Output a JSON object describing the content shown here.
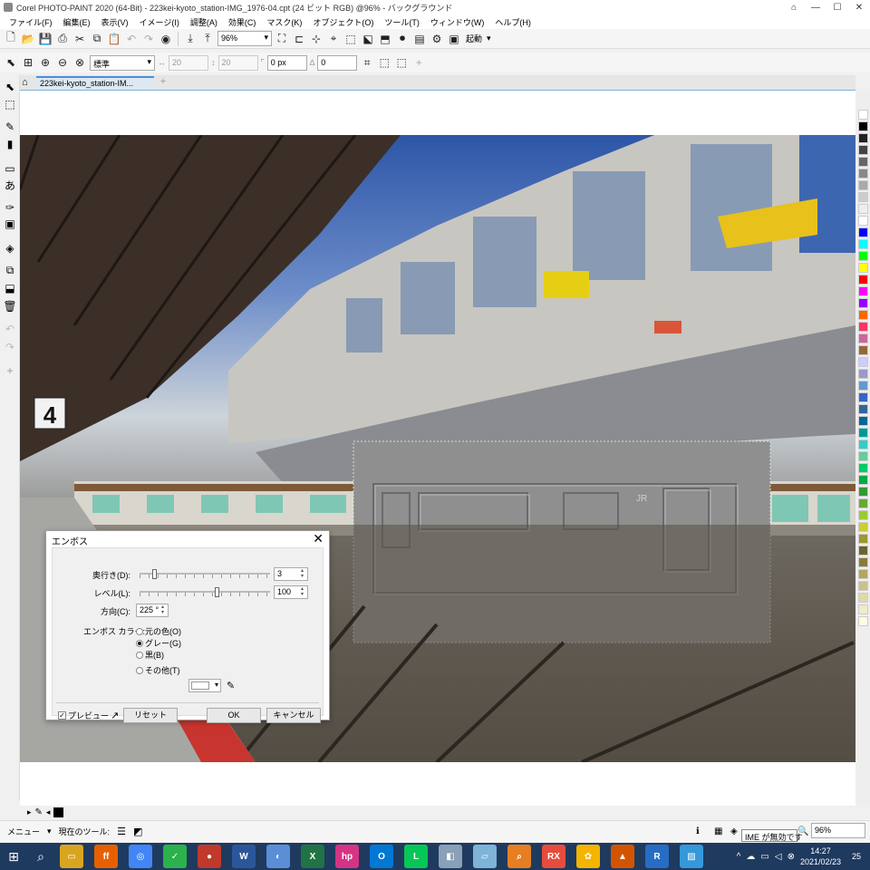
{
  "window": {
    "title": "Corel PHOTO-PAINT 2020 (64-Bit) - 223kei-kyoto_station-IMG_1976-04.cpt (24 ビット RGB) @96% - バックグラウンド",
    "min": "—",
    "max": "☐",
    "close": "✕"
  },
  "menu": [
    "ファイル(F)",
    "編集(E)",
    "表示(V)",
    "イメージ(I)",
    "調整(A)",
    "効果(C)",
    "マスク(K)",
    "オブジェクト(O)",
    "ツール(T)",
    "ウィンドウ(W)",
    "ヘルプ(H)"
  ],
  "toolbar": {
    "zoom": "96%",
    "launch": "起動"
  },
  "property_bar": {
    "mode": "標準",
    "width": "20",
    "height": "20",
    "feather": "0 px",
    "angle": "0"
  },
  "tabs": {
    "doc_tab": "223kei-kyoto_station-IM..."
  },
  "photo": {
    "platform_sign": "4",
    "train_logo": "JR"
  },
  "dialog": {
    "title": "エンボス",
    "depth_label": "奥行き(D):",
    "depth_value": "3",
    "level_label": "レベル(L):",
    "level_value": "100",
    "direction_label": "方向(C):",
    "direction_value": "225 °",
    "color_label": "エンボス カラー:",
    "options": [
      "元の色(O)",
      "グレー(G)",
      "黒(B)",
      "その他(T)"
    ],
    "selected_option": "グレー(G)",
    "depth_level": 0.1,
    "level_level": 0.6,
    "preview_label": "プレビュー",
    "reset_label": "リセット",
    "ok_label": "OK",
    "cancel_label": "キャンセル"
  },
  "status": {
    "menu_label": "メニュー",
    "current_tool_label": "現在のツール:",
    "ime_tooltip": "IME が無効です",
    "zoom": "96%"
  },
  "taskbar": {
    "apps": [
      "Explorer",
      "Firefox",
      "Chrome",
      "Feedly",
      "Photo-Paint",
      "Word",
      "Browser",
      "Excel",
      "hpb",
      "Outlook",
      "LINE",
      "Finder",
      "Files",
      "Search",
      "RX",
      "Photos",
      "MATLAB",
      "R",
      "Paint"
    ],
    "time": "14:27",
    "date": "2021/02/23",
    "notifications": "25"
  },
  "colors": {
    "accent": "#4a90d9",
    "taskbar": "#1f3a5f",
    "sky": "#2d56a8",
    "emboss_gray": "#8f8f8f"
  }
}
